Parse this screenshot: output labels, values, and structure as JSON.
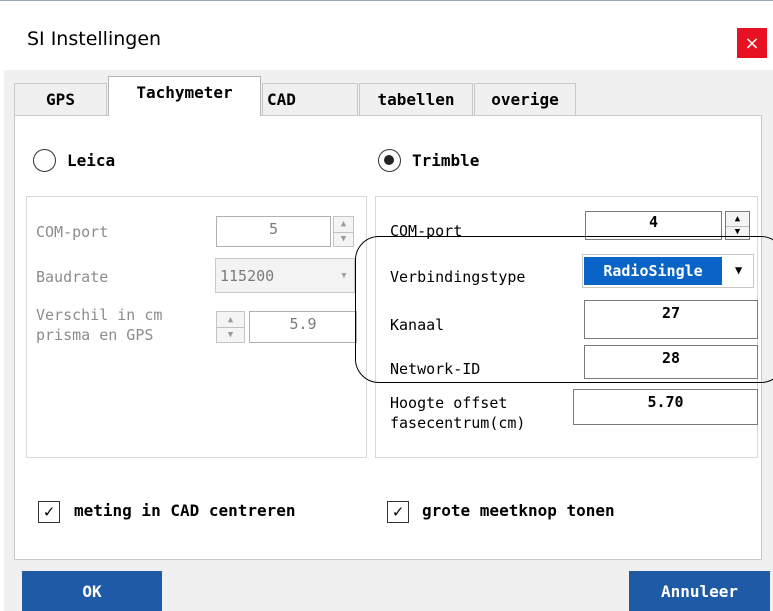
{
  "window": {
    "title": "SI Instellingen",
    "close_glyph": "×"
  },
  "tabs": [
    {
      "label": "GPS",
      "active": false
    },
    {
      "label": "Tachymeter",
      "active": true
    },
    {
      "label": "CAD",
      "active": false
    },
    {
      "label": "tabellen",
      "active": false
    },
    {
      "label": "overige",
      "active": false
    }
  ],
  "leica": {
    "label": "Leica",
    "selected": false,
    "com_port": {
      "label": "COM-port",
      "value": "5"
    },
    "baudrate": {
      "label": "Baudrate",
      "value": "115200"
    },
    "verschil": {
      "label_line1": "Verschil in cm",
      "label_line2": "prisma en GPS",
      "value": "5.9"
    }
  },
  "trimble": {
    "label": "Trimble",
    "selected": true,
    "com_port": {
      "label": "COM-port",
      "value": "4"
    },
    "verbindingstype": {
      "label": "Verbindingstype",
      "value": "RadioSingle"
    },
    "kanaal": {
      "label": "Kanaal",
      "value": "27"
    },
    "network_id": {
      "label": "Network-ID",
      "value": "28"
    },
    "hoogte": {
      "label_line1": "Hoogte offset",
      "label_line2": "fasecentrum(cm)",
      "value": "5.70"
    }
  },
  "checkboxes": [
    {
      "label": "meting in CAD centreren",
      "checked": true
    },
    {
      "label": "grote meetknop tonen",
      "checked": true
    }
  ],
  "buttons": {
    "ok": "OK",
    "cancel": "Annuleer"
  },
  "icons": {
    "check": "✓",
    "spin_up": "▲",
    "spin_down": "▼",
    "dropdown": "▼",
    "dropdown_disabled": "▾"
  },
  "colors": {
    "accent": "#1f5aa6",
    "close": "#e81123",
    "selection": "#0a64c8"
  }
}
